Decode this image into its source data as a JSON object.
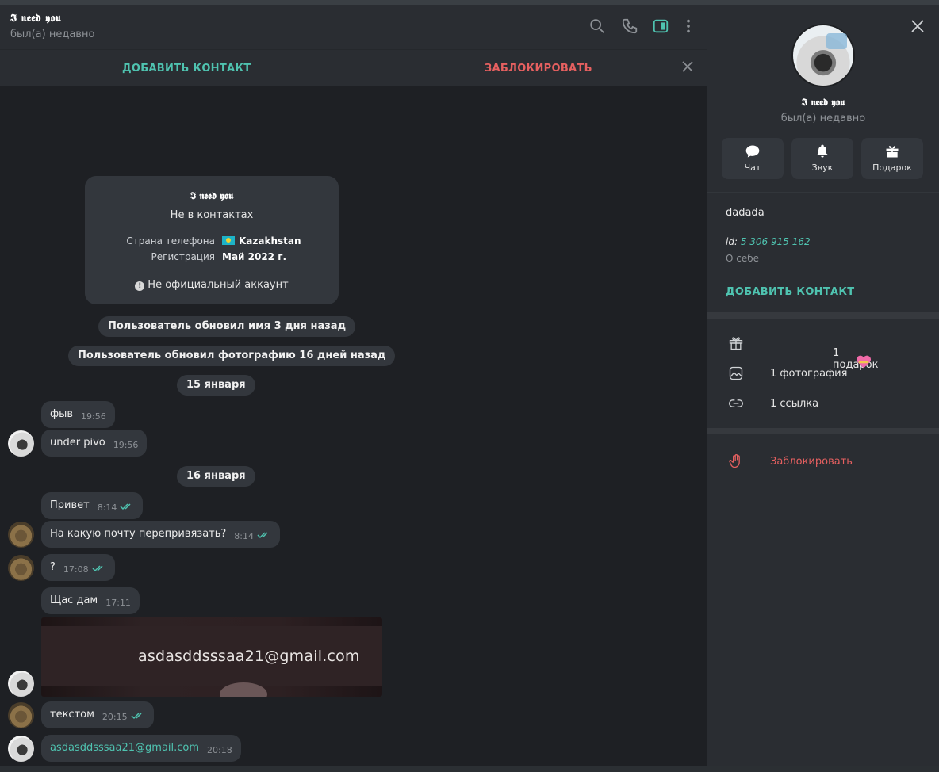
{
  "chat": {
    "title": "𝕴 𝖓𝖊𝖊𝖉 𝖞𝖔𝖚",
    "status": "был(а) недавно",
    "action_add": "ДОБАВИТЬ КОНТАКТ",
    "action_block": "ЗАБЛОКИРОВАТЬ"
  },
  "info_card": {
    "name": "𝕴 𝖓𝖊𝖊𝖉 𝖞𝖔𝖚",
    "status": "Не в контактах",
    "phone_country_label": "Страна телефона",
    "phone_country_value": "Kazakhstan",
    "registration_label": "Регистрация",
    "registration_value": "Май 2022 г.",
    "notice": "Не официальный аккаунт"
  },
  "service": {
    "name_update": "Пользователь обновил имя 3 дня назад",
    "photo_update": "Пользователь обновил фотографию 16 дней назад",
    "date1": "15 января",
    "date2": "16 января"
  },
  "messages": [
    {
      "text": "фыв",
      "time": "19:56"
    },
    {
      "text": "under pivo",
      "time": "19:56"
    },
    {
      "text": "Привет",
      "time": "8:14"
    },
    {
      "text": "На какую почту перепривязать?",
      "time": "8:14"
    },
    {
      "text": "?",
      "time": "17:08"
    },
    {
      "text": "Щас дам",
      "time": "17:11"
    },
    {
      "text": "текстом",
      "time": "20:15"
    },
    {
      "text": "asdasddsssaa21@gmail.com",
      "time": "20:18"
    }
  ],
  "photo": {
    "text": "asdasddsssaa21@gmail.com"
  },
  "profile": {
    "name": "𝕴 𝖓𝖊𝖊𝖉 𝖞𝖔𝖚",
    "status": "был(а) недавно",
    "btn_chat": "Чат",
    "btn_sound": "Звук",
    "btn_gift": "Подарок",
    "bio": "dadada",
    "id_label": "id:",
    "id_value": "5 306 915 162",
    "about_label": "О себе",
    "add_contact": "ДОБАВИТЬ КОНТАКТ",
    "gifts": "1 подарок",
    "photos": "1 фотография",
    "links": "1 ссылка",
    "block": "Заблокировать"
  },
  "colors": {
    "accent": "#4fc3b0",
    "danger": "#e66060",
    "bubble": "#33373d",
    "chat_bg": "#1e2024"
  },
  "icons": [
    "search-icon",
    "phone-icon",
    "sidebar-toggle-icon",
    "more-icon",
    "close-icon",
    "chat-icon",
    "bell-icon",
    "gift-icon",
    "photo-icon",
    "link-icon",
    "hand-stop-icon",
    "double-check-icon"
  ]
}
